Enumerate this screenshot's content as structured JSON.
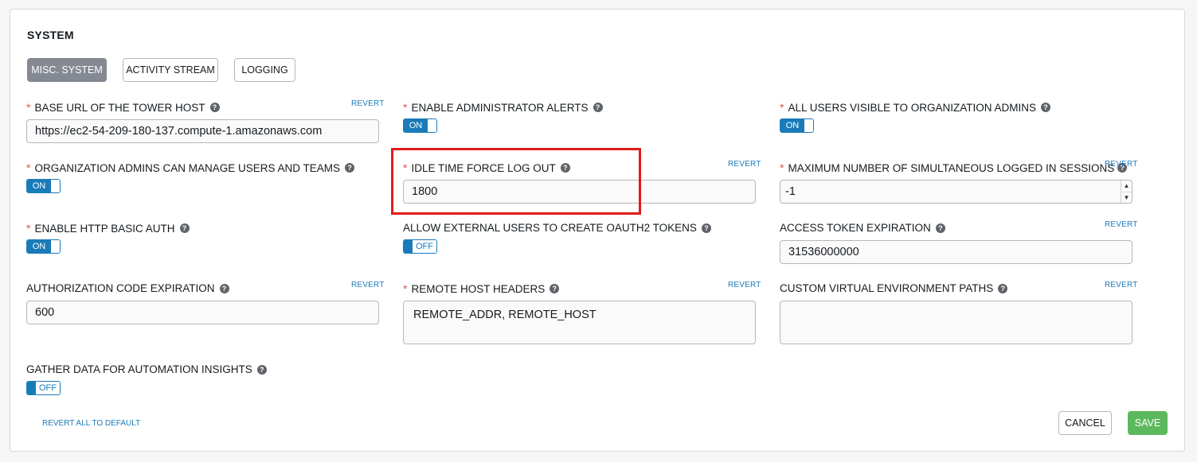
{
  "panel": {
    "title": "SYSTEM"
  },
  "tabs": [
    {
      "label": "MISC. SYSTEM",
      "active": true
    },
    {
      "label": "ACTIVITY STREAM",
      "active": false
    },
    {
      "label": "LOGGING",
      "active": false
    }
  ],
  "fields": {
    "base_url": {
      "label": "BASE URL OF THE TOWER HOST",
      "value": "https://ec2-54-209-180-137.compute-1.amazonaws.com",
      "revert": "REVERT"
    },
    "admin_alerts": {
      "label": "ENABLE ADMINISTRATOR ALERTS",
      "toggle": "ON"
    },
    "users_visible": {
      "label": "ALL USERS VISIBLE TO ORGANIZATION ADMINS",
      "toggle": "ON"
    },
    "org_admins_manage": {
      "label": "ORGANIZATION ADMINS CAN MANAGE USERS AND TEAMS",
      "toggle": "ON"
    },
    "idle_time": {
      "label": "IDLE TIME FORCE LOG OUT",
      "value": "1800",
      "revert": "REVERT"
    },
    "max_sessions": {
      "label": "MAXIMUM NUMBER OF SIMULTANEOUS LOGGED IN SESSIONS",
      "value": "-1",
      "revert": "REVERT"
    },
    "http_basic": {
      "label": "ENABLE HTTP BASIC AUTH",
      "toggle": "ON"
    },
    "oauth2": {
      "label": "ALLOW EXTERNAL USERS TO CREATE OAUTH2 TOKENS",
      "toggle": "OFF"
    },
    "access_token": {
      "label": "ACCESS TOKEN EXPIRATION",
      "value": "31536000000",
      "revert": "REVERT"
    },
    "auth_code": {
      "label": "AUTHORIZATION CODE EXPIRATION",
      "value": "600",
      "revert": "REVERT"
    },
    "remote_headers": {
      "label": "REMOTE HOST HEADERS",
      "value": "REMOTE_ADDR, REMOTE_HOST",
      "revert": "REVERT"
    },
    "venv_paths": {
      "label": "CUSTOM VIRTUAL ENVIRONMENT PATHS",
      "value": "",
      "revert": "REVERT"
    },
    "insights": {
      "label": "GATHER DATA FOR AUTOMATION INSIGHTS",
      "toggle": "OFF"
    }
  },
  "help_glyph": "?",
  "required_mark": "*",
  "footer": {
    "revert_all": "REVERT ALL TO DEFAULT",
    "cancel": "CANCEL",
    "save": "SAVE"
  },
  "colors": {
    "accent": "#1a7bb9",
    "required": "#d9534f",
    "save": "#5cb85c",
    "active_tab": "#848992",
    "highlight": "#e21b1b"
  }
}
